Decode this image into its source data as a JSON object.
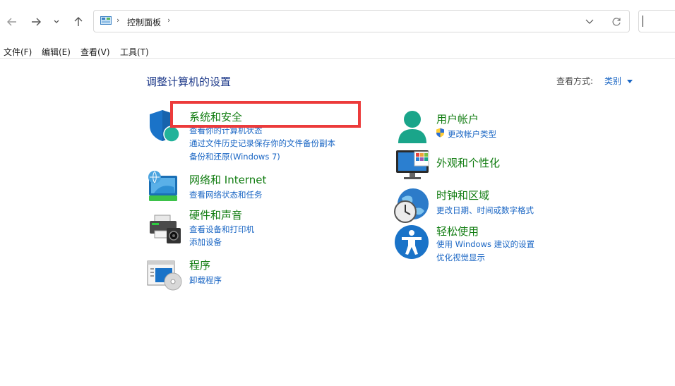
{
  "nav": {
    "address_path": "控制面板"
  },
  "menu": [
    "文件(F)",
    "编辑(E)",
    "查看(V)",
    "工具(T)"
  ],
  "page_title": "调整计算机的设置",
  "view_by": {
    "label": "查看方式:",
    "value": "类别"
  },
  "left_categories": [
    {
      "title": "系统和安全",
      "links": [
        "查看你的计算机状态",
        "通过文件历史记录保存你的文件备份副本",
        "备份和还原(Windows 7)"
      ],
      "icon": "shield-icon"
    },
    {
      "title": "网络和 Internet",
      "links": [
        "查看网络状态和任务"
      ],
      "icon": "network-icon"
    },
    {
      "title": "硬件和声音",
      "links": [
        "查看设备和打印机",
        "添加设备"
      ],
      "icon": "printer-icon"
    },
    {
      "title": "程序",
      "links": [
        "卸载程序"
      ],
      "icon": "programs-icon"
    }
  ],
  "right_categories": [
    {
      "title": "用户帐户",
      "links": [
        "更改帐户类型"
      ],
      "icon": "user-icon"
    },
    {
      "title": "外观和个性化",
      "links": [],
      "icon": "monitor-icon"
    },
    {
      "title": "时钟和区域",
      "links": [
        "更改日期、时间或数字格式"
      ],
      "icon": "clock-globe-icon"
    },
    {
      "title": "轻松使用",
      "links": [
        "使用 Windows 建议的设置",
        "优化视觉显示"
      ],
      "icon": "accessibility-icon"
    }
  ],
  "colors": {
    "category_title": "#107c10",
    "link": "#1a66c4",
    "highlight_box": "#ec3b3b"
  }
}
